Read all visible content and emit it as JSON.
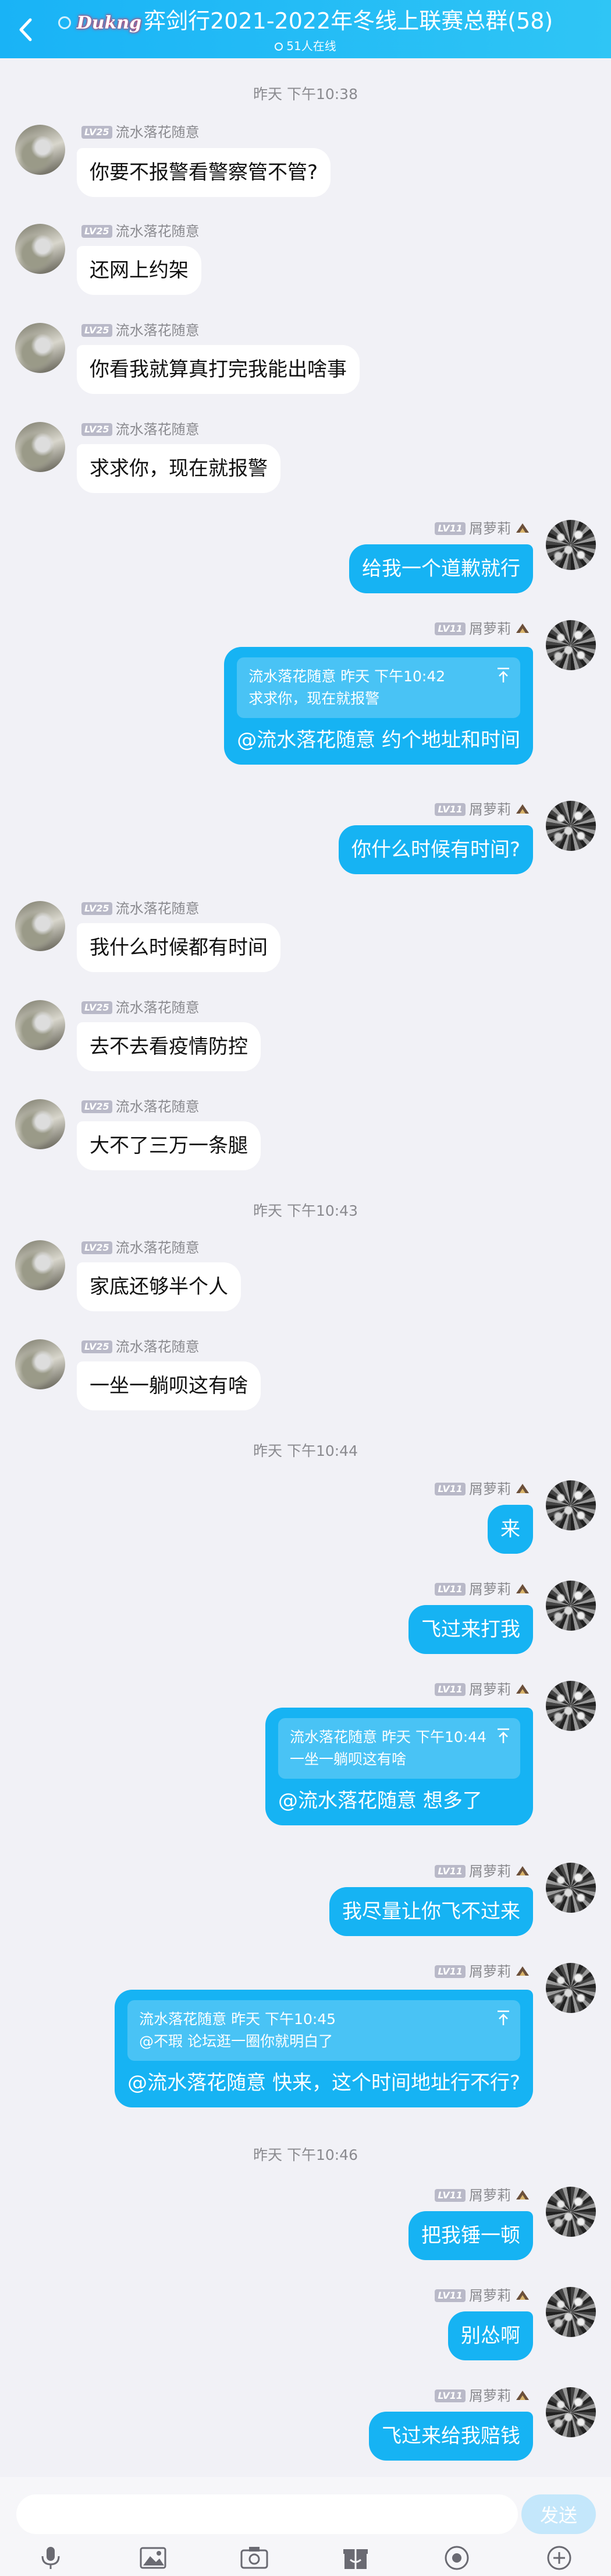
{
  "header": {
    "logo_text": "Dukng",
    "title": "弈剑行2021-2022年冬线上联赛总群(58)",
    "online": "51人在线",
    "colors": {
      "bar": "#19b3f6",
      "bubble_self": "#16b3f3",
      "bubble_other": "#ffffff"
    }
  },
  "timestamps": [
    "昨天 下午10:38",
    "昨天 下午10:43",
    "昨天 下午10:44",
    "昨天 下午10:46"
  ],
  "users": {
    "other": {
      "name": "流水落花随意",
      "level": "LV25"
    },
    "self": {
      "name": "屑萝莉",
      "level": "LV11"
    }
  },
  "messages": [
    {
      "text": "你要不报警看警察管不管?"
    },
    {
      "text": "还网上约架"
    },
    {
      "text": "你看我就算真打完我能出啥事"
    },
    {
      "text": "求求你，现在就报警"
    },
    {
      "text": "给我一个道歉就行"
    },
    {
      "quote_head": "流水落花随意 昨天 下午10:42",
      "quote_body": "求求你，现在就报警",
      "text": "@流水落花随意 约个地址和时间"
    },
    {
      "text": "你什么时候有时间?"
    },
    {
      "text": "我什么时候都有时间"
    },
    {
      "text": "去不去看疫情防控"
    },
    {
      "text": "大不了三万一条腿"
    },
    {
      "text": "家底还够半个人"
    },
    {
      "text": "一坐一躺呗这有啥"
    },
    {
      "text": "来"
    },
    {
      "text": "飞过来打我"
    },
    {
      "quote_head": "流水落花随意 昨天 下午10:44",
      "quote_body": "一坐一躺呗这有啥",
      "text": "@流水落花随意 想多了"
    },
    {
      "text": "我尽量让你飞不过来"
    },
    {
      "quote_head": "流水落花随意 昨天 下午10:45",
      "quote_body": "@不瑕 论坛逛一圈你就明白了",
      "text": "@流水落花随意 快来，这个时间地址行不行?"
    },
    {
      "text": "把我锤一顿"
    },
    {
      "text": "别怂啊"
    },
    {
      "text": "飞过来给我赔钱"
    }
  ],
  "input": {
    "placeholder": "",
    "send_label": "发送"
  },
  "toolbar": [
    "mic-icon",
    "image-icon",
    "camera-icon",
    "gift-icon",
    "emoji-icon",
    "plus-icon"
  ]
}
